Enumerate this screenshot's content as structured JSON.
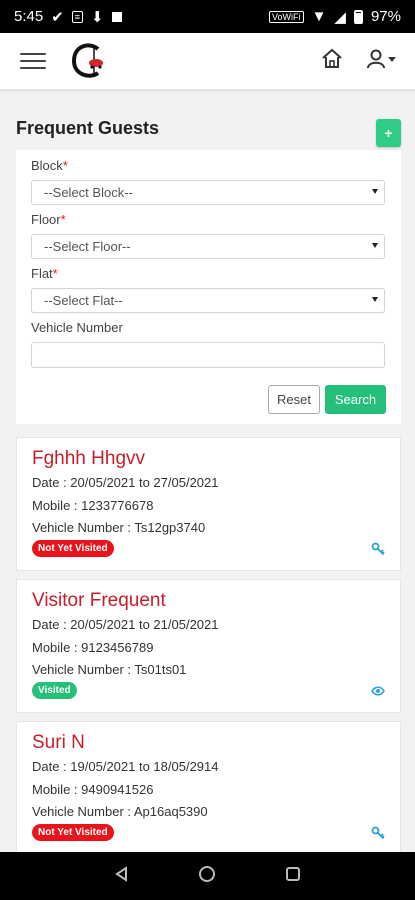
{
  "status": {
    "time": "5:45",
    "network_tag": "VoWiFi",
    "battery": "97%"
  },
  "header": {
    "menu_icon": "menu-icon",
    "home_icon": "home-icon",
    "user_icon": "user-icon"
  },
  "page": {
    "title": "Frequent Guests",
    "add_label": "+"
  },
  "filters": {
    "block_label": "Block",
    "block_value": "--Select Block--",
    "floor_label": "Floor",
    "floor_value": "--Select Floor--",
    "flat_label": "Flat",
    "flat_value": "--Select Flat--",
    "required_mark": "*",
    "vehicle_label": "Vehicle Number",
    "vehicle_value": "",
    "reset_label": "Reset",
    "search_label": "Search"
  },
  "guests": [
    {
      "name": "Fghhh Hhgvv",
      "date": "Date : 20/05/2021 to 27/05/2021",
      "mobile": "Mobile : 1233776678",
      "vehicle": "Vehicle Number : Ts12gp3740",
      "status": "Not Yet Visited",
      "status_color": "#e8141b",
      "action_icon": "key-icon"
    },
    {
      "name": "Visitor Frequent",
      "date": "Date : 20/05/2021 to 21/05/2021",
      "mobile": "Mobile : 9123456789",
      "vehicle": "Vehicle Number : Ts01ts01",
      "status": "Visited",
      "status_color": "#27c07a",
      "action_icon": "eye-icon"
    },
    {
      "name": "Suri N",
      "date": "Date : 19/05/2021 to 18/05/2914",
      "mobile": "Mobile : 9490941526",
      "vehicle": "Vehicle Number : Ap16aq5390",
      "status": "Not Yet Visited",
      "status_color": "#e8141b",
      "action_icon": "key-icon"
    }
  ],
  "colors": {
    "accent_green": "#24c07a",
    "name_red": "#c81e2b",
    "required_red": "#e02020"
  }
}
